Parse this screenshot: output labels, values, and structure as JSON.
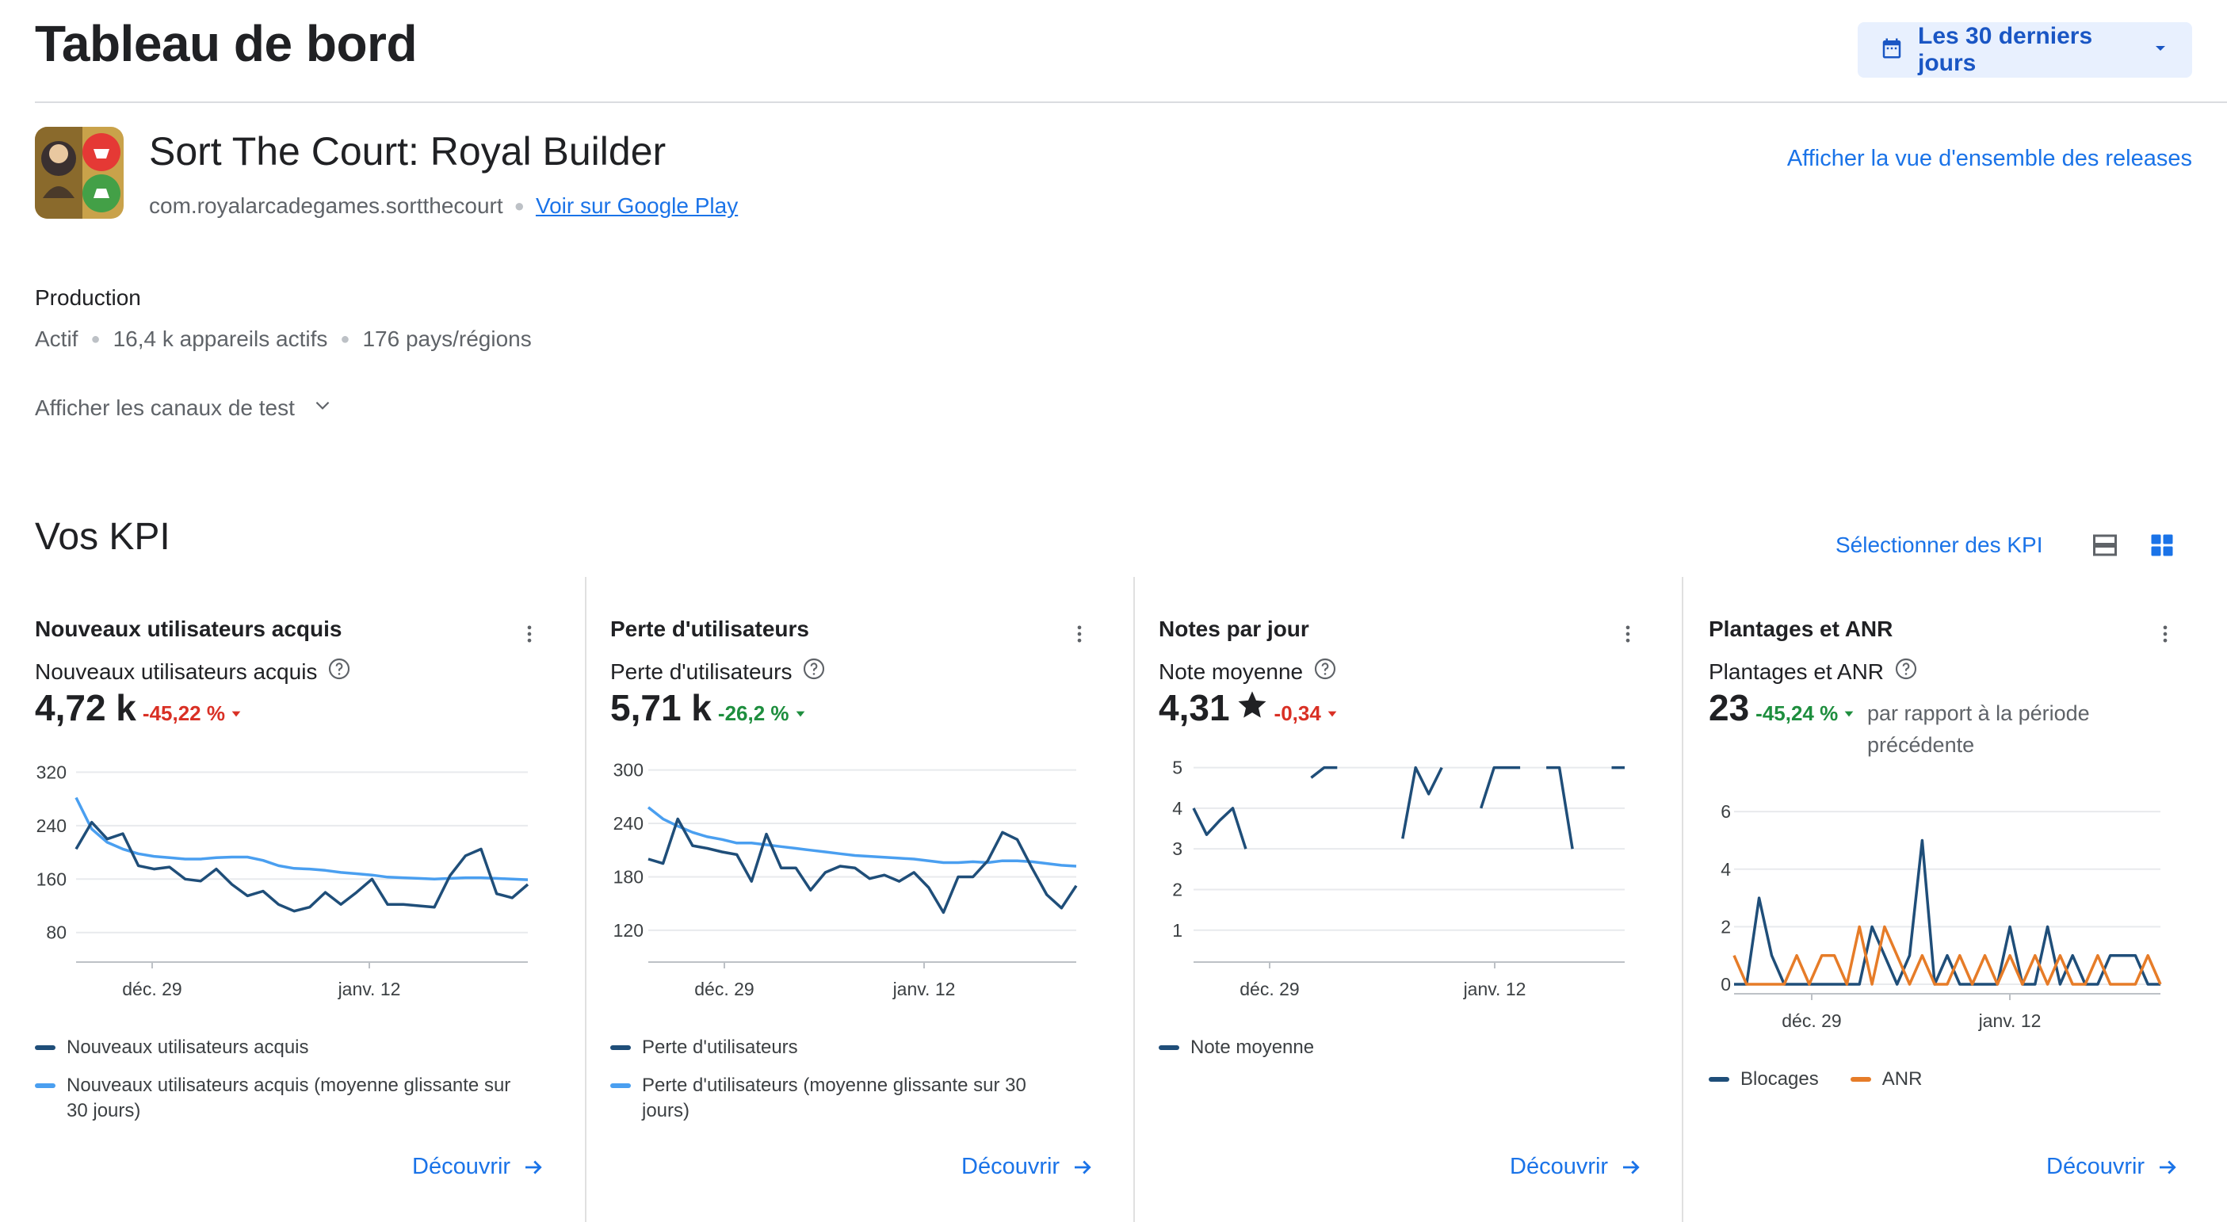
{
  "header": {
    "title": "Tableau de bord",
    "date_range": "Les 30 derniers jours"
  },
  "app": {
    "name": "Sort The Court: Royal Builder",
    "package": "com.royalarcadegames.sortthecourt",
    "play_link": "Voir sur Google Play",
    "release_overview_link": "Afficher la vue d'ensemble des releases"
  },
  "production": {
    "title": "Production",
    "status": "Actif",
    "devices": "16,4 k appareils actifs",
    "countries": "176 pays/régions",
    "test_channels": "Afficher les canaux de test"
  },
  "kpi": {
    "title": "Vos KPI",
    "select_label": "Sélectionner des KPI"
  },
  "colors": {
    "dark_series": "#1f4e79",
    "light_series": "#4a9ff0",
    "orange_series": "#e67c28",
    "accent": "#1a73e8"
  },
  "cards": [
    {
      "title": "Nouveaux utilisateurs acquis",
      "subtitle": "Nouveaux utilisateurs acquis",
      "value": "4,72 k",
      "delta": "-45,22 %",
      "delta_color": "red",
      "legend": [
        "Nouveaux utilisateurs acquis",
        "Nouveaux utilisateurs acquis (moyenne glissante sur 30 jours)"
      ],
      "discover": "Découvrir"
    },
    {
      "title": "Perte d'utilisateurs",
      "subtitle": "Perte d'utilisateurs",
      "value": "5,71 k",
      "delta": "-26,2 %",
      "delta_color": "green",
      "legend": [
        "Perte d'utilisateurs",
        "Perte d'utilisateurs (moyenne glissante sur 30 jours)"
      ],
      "discover": "Découvrir"
    },
    {
      "title": "Notes par jour",
      "subtitle": "Note moyenne",
      "value": "4,31",
      "delta": "-0,34",
      "delta_color": "red",
      "legend": [
        "Note moyenne"
      ],
      "discover": "Découvrir"
    },
    {
      "title": "Plantages et ANR",
      "subtitle": "Plantages et ANR",
      "value": "23",
      "delta": "-45,24 %",
      "delta_color": "green",
      "compare_text": "par rapport à la période précédente",
      "legend": [
        "Blocages",
        "ANR"
      ],
      "discover": "Découvrir"
    }
  ],
  "chart_data": [
    {
      "type": "line",
      "x_tick_labels": [
        "déc. 29",
        "janv. 12"
      ],
      "y_ticks": [
        80,
        160,
        240,
        320
      ],
      "ylim": [
        50,
        330
      ],
      "series": [
        {
          "name": "Nouveaux utilisateurs acquis",
          "color": "dark",
          "values": [
            205,
            245,
            220,
            228,
            180,
            175,
            178,
            160,
            157,
            175,
            152,
            135,
            142,
            122,
            112,
            118,
            140,
            122,
            140,
            160,
            122,
            122,
            120,
            118,
            165,
            195,
            205,
            138,
            132,
            152
          ]
        },
        {
          "name": "Nouveaux utilisateurs acquis (moyenne glissante sur 30 jours)",
          "color": "light",
          "values": [
            282,
            235,
            215,
            205,
            198,
            194,
            192,
            190,
            190,
            192,
            193,
            193,
            188,
            180,
            176,
            175,
            173,
            170,
            168,
            166,
            163,
            162,
            161,
            160,
            161,
            162,
            162,
            161,
            160,
            159
          ]
        }
      ]
    },
    {
      "type": "line",
      "x_tick_labels": [
        "déc. 29",
        "janv. 12"
      ],
      "y_ticks": [
        120,
        180,
        240,
        300
      ],
      "ylim": [
        95,
        305
      ],
      "series": [
        {
          "name": "Perte d'utilisateurs",
          "color": "dark",
          "values": [
            200,
            195,
            245,
            215,
            212,
            208,
            205,
            175,
            228,
            190,
            190,
            165,
            185,
            192,
            190,
            178,
            182,
            175,
            185,
            168,
            140,
            180,
            180,
            198,
            230,
            222,
            190,
            160,
            145,
            170
          ]
        },
        {
          "name": "Perte d'utilisateurs (moyenne glissante sur 30 jours)",
          "color": "light",
          "values": [
            258,
            245,
            237,
            230,
            225,
            222,
            218,
            218,
            216,
            214,
            212,
            210,
            208,
            206,
            204,
            203,
            202,
            201,
            200,
            198,
            196,
            196,
            197,
            196,
            198,
            198,
            197,
            195,
            193,
            192
          ]
        }
      ]
    },
    {
      "type": "line",
      "x_tick_labels": [
        "déc. 29",
        "janv. 12"
      ],
      "y_ticks": [
        1,
        2,
        3,
        4,
        5
      ],
      "ylim": [
        0.45,
        5.05
      ],
      "series": [
        {
          "name": "Note moyenne",
          "color": "dark",
          "values": [
            4,
            3.35,
            3.7,
            4,
            3,
            null,
            null,
            null,
            null,
            4.75,
            5,
            5,
            null,
            null,
            null,
            null,
            3.25,
            5,
            4.35,
            5,
            null,
            null,
            4,
            5,
            5,
            5,
            null,
            5,
            5,
            3,
            null,
            null,
            5,
            5
          ]
        }
      ]
    },
    {
      "type": "line",
      "x_tick_labels": [
        "déc. 29",
        "janv. 12"
      ],
      "y_ticks": [
        0,
        2,
        4,
        6
      ],
      "ylim": [
        0,
        6.5
      ],
      "series": [
        {
          "name": "Blocages",
          "color": "dark",
          "values": [
            0,
            0,
            3,
            1,
            0,
            0,
            0,
            0,
            0,
            0,
            0,
            2,
            1,
            0,
            1,
            5,
            0,
            1,
            0,
            0,
            0,
            0,
            2,
            0,
            0,
            2,
            0,
            1,
            0,
            0,
            1,
            1,
            1,
            0,
            0
          ]
        },
        {
          "name": "ANR",
          "color": "orange",
          "values": [
            1,
            0,
            0,
            0,
            0,
            1,
            0,
            1,
            1,
            0,
            2,
            0,
            2,
            1,
            0,
            1,
            0,
            0,
            1,
            0,
            1,
            0,
            1,
            0,
            1,
            0,
            1,
            0,
            0,
            1,
            0,
            0,
            0,
            1,
            0
          ]
        }
      ]
    }
  ]
}
